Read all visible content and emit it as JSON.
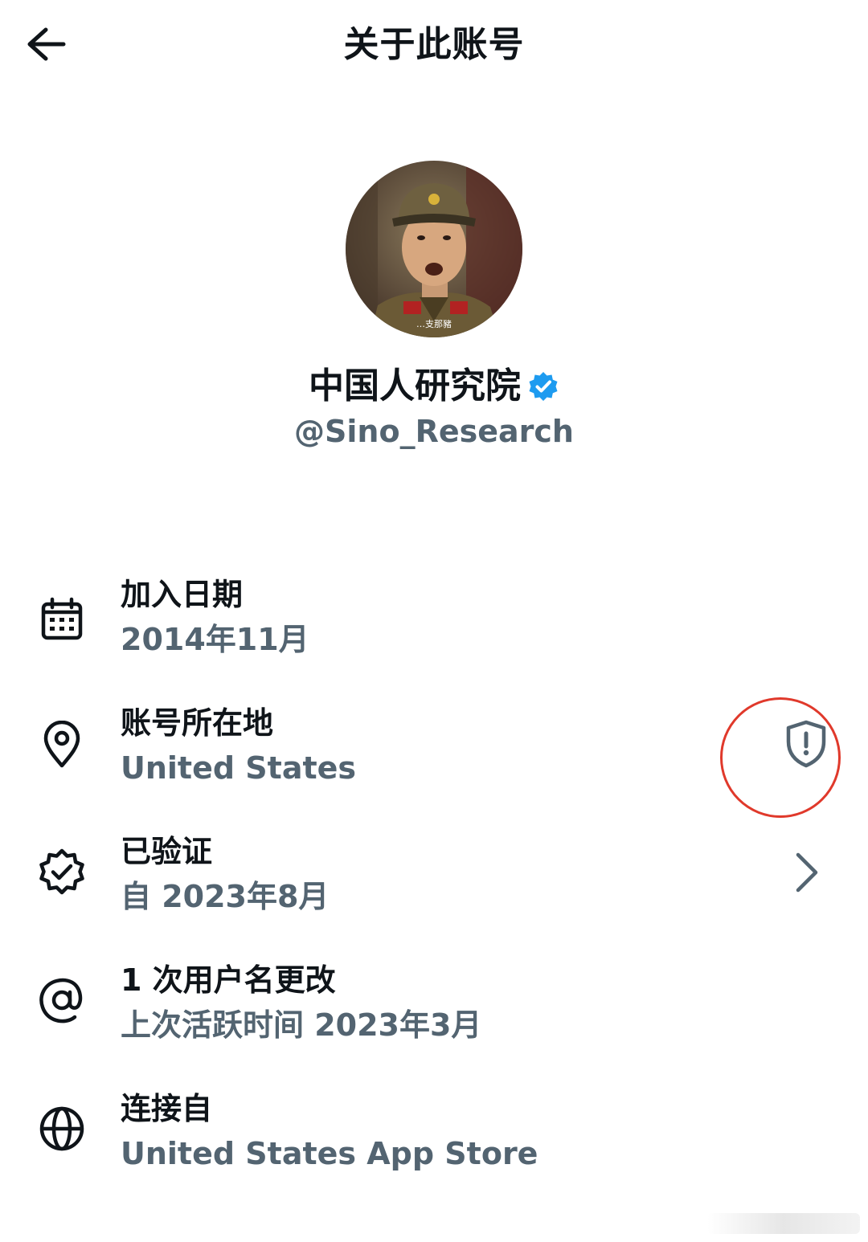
{
  "header": {
    "title": "关于此账号",
    "back_icon": "arrow-left-icon"
  },
  "profile": {
    "avatar_caption": "…支那豬",
    "display_name": "中国人研究院",
    "verified": true,
    "handle": "@Sino_Research"
  },
  "rows": [
    {
      "icon": "calendar-icon",
      "label": "加入日期",
      "value": "2014年11月"
    },
    {
      "icon": "location-pin-icon",
      "label": "账号所在地",
      "value": "United States",
      "right_icon": "shield-alert-icon"
    },
    {
      "icon": "verified-badge-icon",
      "label": "已验证",
      "value": "自 2023年8月",
      "right_icon": "chevron-right-icon"
    },
    {
      "icon": "at-sign-icon",
      "label": "1 次用户名更改",
      "value": "上次活跃时间 2023年3月"
    },
    {
      "icon": "globe-icon",
      "label": "连接自",
      "value": "United States App Store"
    }
  ],
  "colors": {
    "primary_text": "#0f1419",
    "secondary_text": "#536471",
    "verified_blue": "#1d9bf0",
    "highlight_red": "#e0392b"
  }
}
